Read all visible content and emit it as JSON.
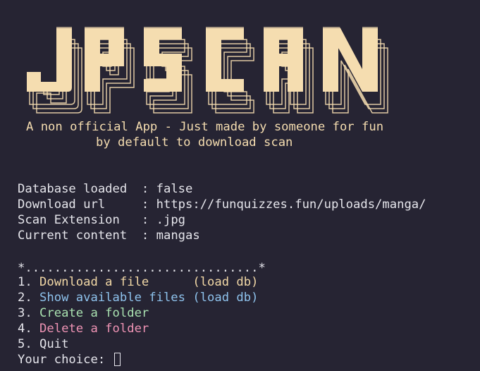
{
  "banner": {
    "logo_text": "JPSCAN",
    "color": "#f5ddb0",
    "tagline_1": "A non official App - Just made by someone for fun",
    "tagline_2": "by default to download scan"
  },
  "info": [
    {
      "key": "Database loaded  ",
      "value": ": false"
    },
    {
      "key": "Download url     ",
      "value": ": https://funquizzes.fun/uploads/manga/"
    },
    {
      "key": "Scan Extension   ",
      "value": ": .jpg"
    },
    {
      "key": "Current content  ",
      "value": ": mangas"
    }
  ],
  "menu": {
    "separator": "*................................*",
    "items": [
      {
        "num": "1. ",
        "label": "Download a file      (load db)",
        "color": "#f2d8a6"
      },
      {
        "num": "2. ",
        "label": "Show available files (load db)",
        "color": "#8ec2ec"
      },
      {
        "num": "3. ",
        "label": "Create a folder",
        "color": "#a9e1b0"
      },
      {
        "num": "4. ",
        "label": "Delete a folder",
        "color": "#ee93b4"
      },
      {
        "num": "5. ",
        "label": "Quit",
        "color": "#e6e6ec"
      }
    ]
  },
  "prompt": {
    "label": "Your choice: ",
    "input_value": ""
  }
}
